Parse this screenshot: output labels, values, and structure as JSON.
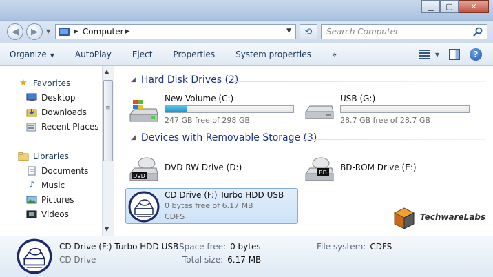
{
  "window": {
    "minimize_glyph": "▁",
    "maximize_glyph": "▢",
    "close_glyph": "✕"
  },
  "address_bar": {
    "crumb": "Computer",
    "search_placeholder": "Search Computer"
  },
  "toolbar": {
    "organize": "Organize",
    "autoplay": "AutoPlay",
    "eject": "Eject",
    "properties": "Properties",
    "system_properties": "System properties",
    "more": "»"
  },
  "nav": {
    "favorites": "Favorites",
    "favorites_items": [
      "Desktop",
      "Downloads",
      "Recent Places"
    ],
    "libraries": "Libraries",
    "libraries_items": [
      "Documents",
      "Music",
      "Pictures",
      "Videos"
    ]
  },
  "groups": {
    "hard_disk_drives": "Hard Disk Drives (2)",
    "removable_storage": "Devices with Removable Storage (3)"
  },
  "drives": {
    "new_volume": {
      "name": "New Volume (C:)",
      "free": "247 GB free of 298 GB",
      "used_fraction": 0.171
    },
    "usb": {
      "name": "USB (G:)",
      "free": "28.7 GB free of 28.7 GB",
      "used_fraction": 0.0
    },
    "dvd": {
      "name": "DVD RW Drive (D:)",
      "badge": "DVD"
    },
    "bd": {
      "name": "BD-ROM Drive (E:)",
      "badge": "BD"
    },
    "cd": {
      "name": "CD Drive (F:) Turbo HDD USB",
      "free": "0 bytes free of 6.17 MB",
      "fs": "CDFS"
    }
  },
  "watermark": {
    "text": "TechwareLabs"
  },
  "details": {
    "name": "CD Drive (F:) Turbo HDD USB",
    "kind": "CD Drive",
    "space_free_label": "Space free:",
    "space_free": "0 bytes",
    "total_size_label": "Total size:",
    "total_size": "6.17 MB",
    "filesystem_label": "File system:",
    "filesystem": "CDFS"
  },
  "colors": {
    "group_heading": "#1e3287",
    "selection_bg": "#cde2f8",
    "bar_fill": "#26a0da"
  }
}
